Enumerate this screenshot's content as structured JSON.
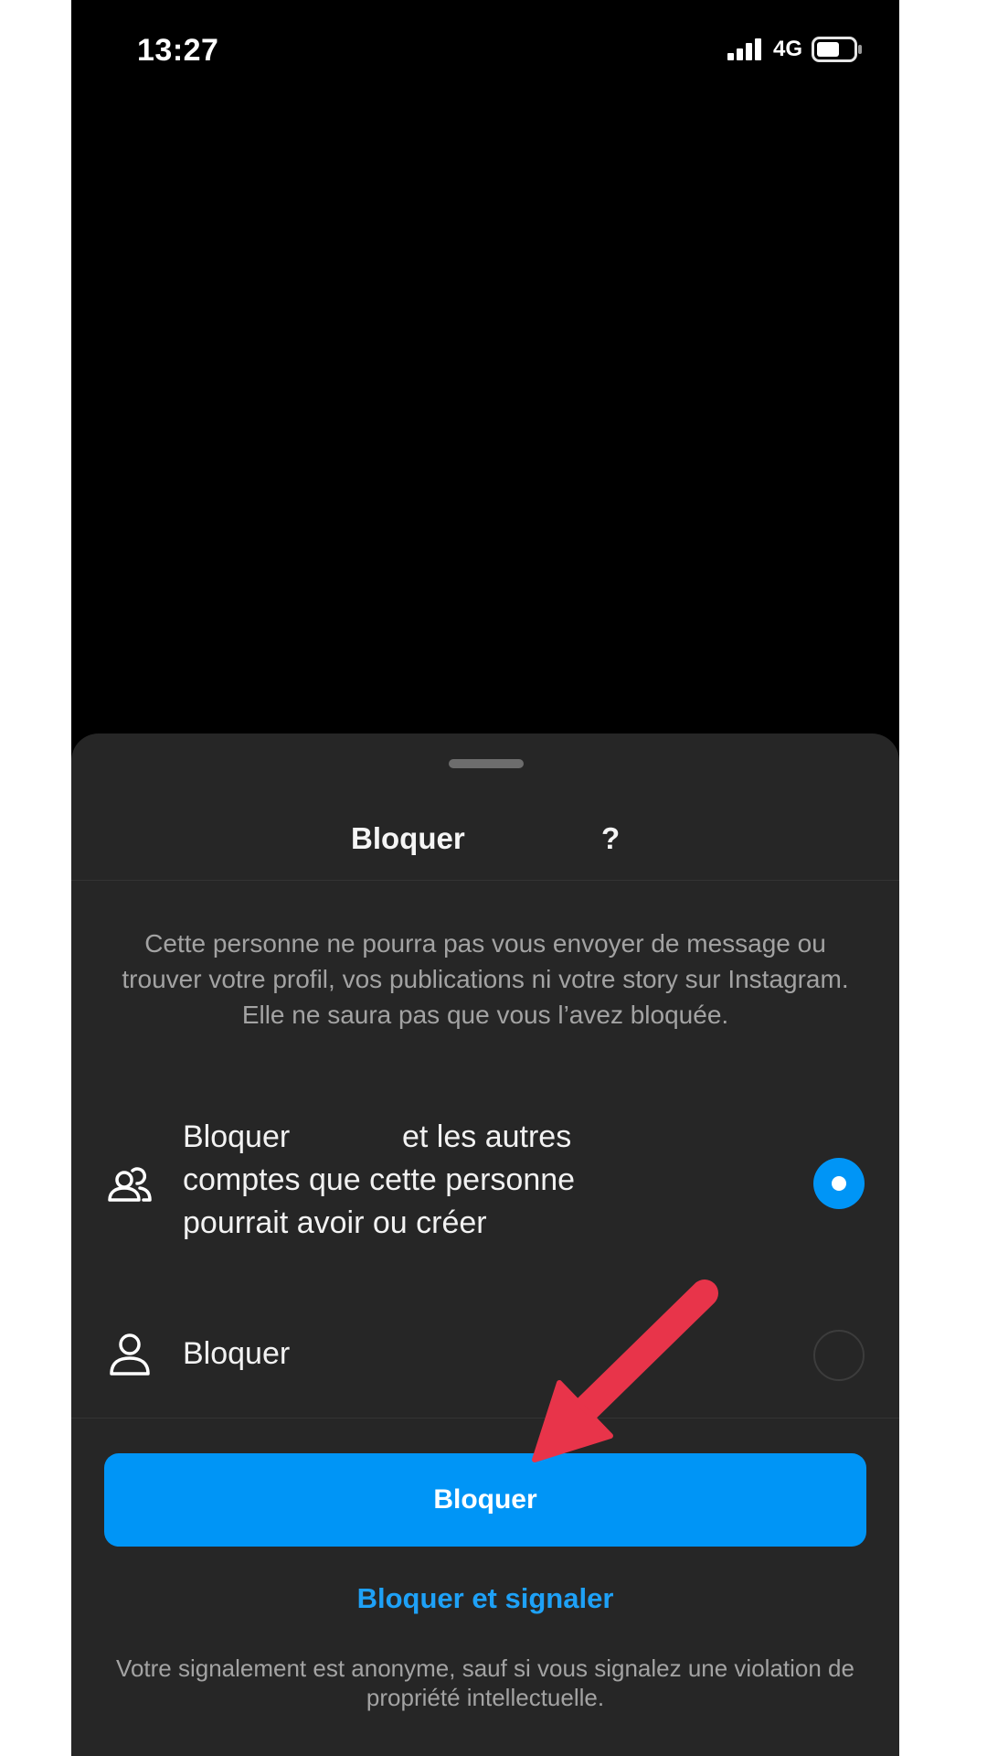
{
  "status_bar": {
    "time": "13:27",
    "network": "4G",
    "icons": [
      "signal-bars-icon",
      "battery-icon"
    ]
  },
  "sheet": {
    "title": {
      "verb": "Bloquer",
      "question_mark": "?"
    },
    "description": "Cette personne ne pourra pas vous envoyer de message ou trouver votre profil, vos publications ni votre story sur Instagram. Elle ne saura pas que vous l’avez bloquée.",
    "options": [
      {
        "icon": "people-icon",
        "lines": [
          "Bloquer             et les autres",
          "comptes que cette personne",
          "pourrait avoir ou créer"
        ],
        "selected": true
      },
      {
        "icon": "person-icon",
        "lines": [
          "Bloquer"
        ],
        "selected": false
      }
    ],
    "primary_button": "Bloquer",
    "secondary_link": "Bloquer et signaler",
    "footer_note": "Votre signalement est anonyme, sauf si vous signalez une violation de propriété intellectuelle."
  },
  "annotation": {
    "icon": "red-arrow-icon",
    "color": "#e8344a"
  },
  "colors": {
    "accent": "#0095f6",
    "sheet_bg": "#262626",
    "background": "#000000"
  }
}
